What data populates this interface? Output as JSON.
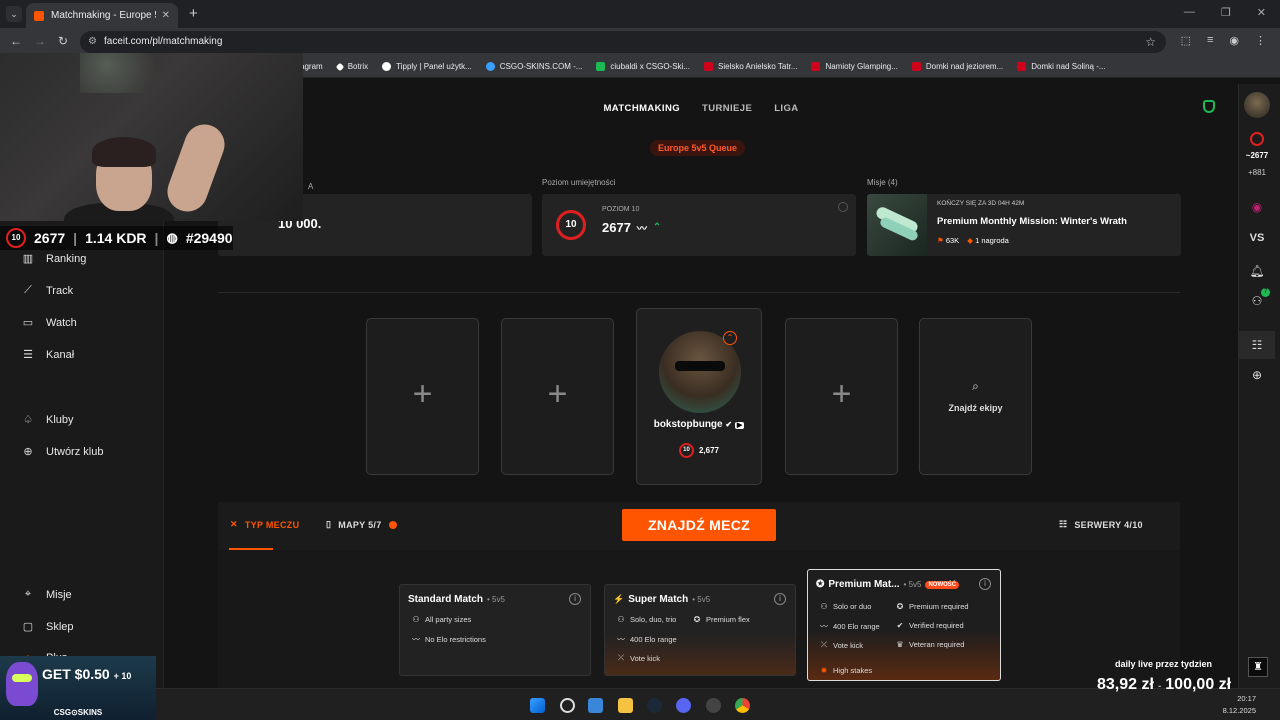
{
  "browser": {
    "tab_title": "Matchmaking - Europe 5v5 Qu",
    "url": "faceit.com/pl/matchmaking",
    "bookmarks": [
      {
        "label": "agram",
        "color": "#e1306c"
      },
      {
        "label": "Botrix",
        "color": "#ffffff"
      },
      {
        "label": "Tipply | Panel użytk...",
        "color": "#ffffff"
      },
      {
        "label": "CSGO-SKINS.COM -...",
        "color": "#3aa0ff"
      },
      {
        "label": "ciubaldi x CSGO-Ski...",
        "color": "#1db954"
      },
      {
        "label": "Sielsko Anielsko Tatr...",
        "color": "#d0021b"
      },
      {
        "label": "Namioty Glamping...",
        "color": "#d0021b"
      },
      {
        "label": "Domki nad jeziorem...",
        "color": "#d0021b"
      },
      {
        "label": "Domki nad Soliną -...",
        "color": "#d0021b"
      }
    ]
  },
  "stream_overlay": {
    "elo": "2677",
    "kdr": "1.14 KDR",
    "rank": "#29490",
    "level": "10"
  },
  "sidebar": {
    "items": [
      {
        "label": "Ranking",
        "icon": "ranking-icon"
      },
      {
        "label": "Track",
        "icon": "track-icon"
      },
      {
        "label": "Watch",
        "icon": "watch-icon"
      },
      {
        "label": "Kanał",
        "icon": "channel-icon"
      },
      {
        "label": "Kluby",
        "icon": "clubs-icon"
      },
      {
        "label": "Utwórz klub",
        "icon": "create-club-icon"
      },
      {
        "label": "Misje",
        "icon": "missions-icon"
      },
      {
        "label": "Sklep",
        "icon": "shop-icon"
      },
      {
        "label": "Plus",
        "icon": "plus-icon"
      }
    ]
  },
  "topnav": {
    "items": [
      "MATCHMAKING",
      "TURNIEJE",
      "LIGA"
    ],
    "active": "MATCHMAKING",
    "queue": "Europe 5v5 Queue"
  },
  "cards": {
    "points_value": "10 000.",
    "points_partial_label": "A",
    "skill_label": "Poziom umiejętności",
    "skill_level_text": "POZIOM 10",
    "skill_level": "10",
    "skill_elo": "2677",
    "missions_label": "Misje (4)",
    "mission_timer": "KOŃCZY SIĘ ZA 3D 04H 42M",
    "mission_title": "Premium Monthly Mission: Winter's Wrath",
    "mission_points": "63K",
    "mission_rewards": "1 nagroda"
  },
  "party": {
    "player_name": "bokstopbunge",
    "player_elo": "2,677",
    "player_level": "10",
    "find_team_label": "Znajdź ekipy"
  },
  "matchmaking_bar": {
    "match_type_label": "TYP MECZU",
    "maps_label": "MAPY 5/7",
    "find_match_label": "ZNAJDŹ MECZ",
    "servers_label": "SERWERY 4/10",
    "accent": "#ff5500"
  },
  "modes": [
    {
      "title": "Standard Match",
      "size": "5v5",
      "features": [
        "All party sizes",
        "No Elo restrictions"
      ]
    },
    {
      "title": "Super Match",
      "size": "5v5",
      "features": [
        "Solo, duo, trio",
        "Premium flex",
        "400 Elo range",
        "Vote kick"
      ]
    },
    {
      "title": "Premium Mat...",
      "size": "5v5",
      "badge": "NOWOŚĆ",
      "features": [
        "Solo or duo",
        "Premium required",
        "400 Elo range",
        "Verified required",
        "Vote kick",
        "Veteran required",
        "High stakes"
      ]
    }
  ],
  "rail": {
    "elo": "~2677",
    "delta": "+881",
    "vs": "VS",
    "friends_count": "7"
  },
  "ad": {
    "text": "GET $0.50",
    "extra": "+ 10",
    "brand": "CSG⊙SKINS"
  },
  "donation": {
    "title": "daily live przez tydzien",
    "current": "83,92 zł",
    "goal": "100,00 zł"
  },
  "taskbar": {
    "time": "20:17",
    "date": "8.12.2025"
  }
}
